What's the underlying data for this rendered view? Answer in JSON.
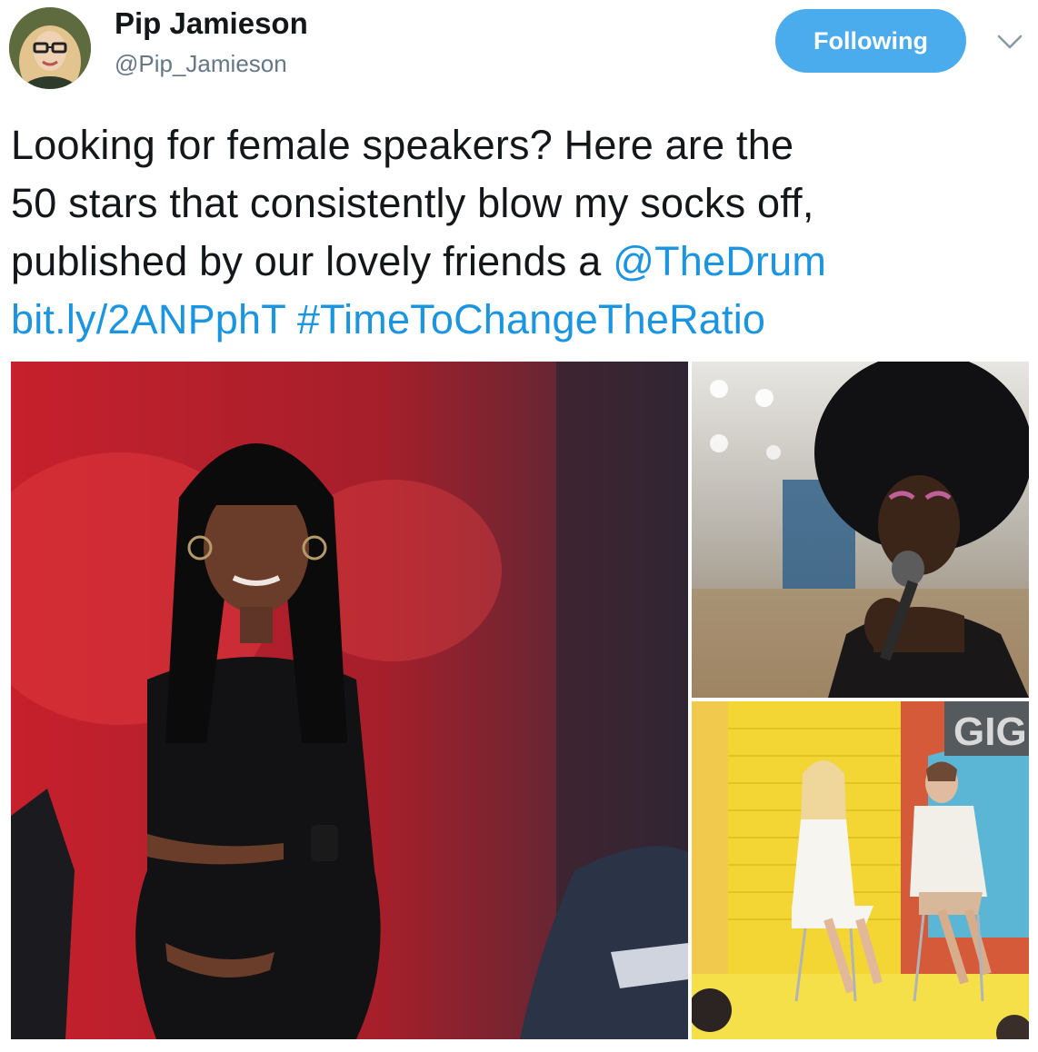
{
  "tweet": {
    "author_name": "Pip Jamieson",
    "author_handle": "@Pip_Jamieson",
    "follow_button_label": "Following",
    "text_lines": [
      "Looking for female speakers? Here are the",
      "50 stars that consistently blow my socks off,",
      "published by our lovely friends a "
    ],
    "mention": "@TheDrum",
    "url": "bit.ly/2ANPphT",
    "hashtag": "#TimeToChangeTheRatio"
  },
  "media": {
    "sign_text": "GIG"
  },
  "colors": {
    "follow_button": "#4aabed",
    "link": "#1b95e0",
    "name": "#14171a",
    "handle": "#657786"
  },
  "icons": {
    "more": "chevron-down-icon"
  }
}
